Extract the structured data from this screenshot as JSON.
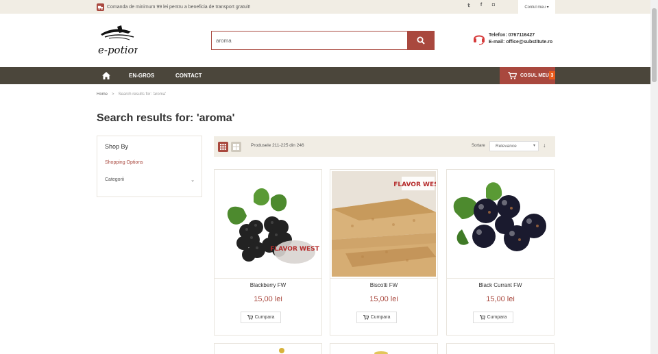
{
  "topbar": {
    "promo": "Comanda de minimum 99 lei pentru a beneficia de transport gratuit!",
    "social": [
      "twitter-icon",
      "facebook-icon",
      "instagram-icon"
    ],
    "account": "Contul meu ▾"
  },
  "header": {
    "logo_text": "e-potion",
    "search_value": "aroma",
    "phone": "Telefon: 0767116427",
    "email": "E-mail: office@substitute.ro"
  },
  "nav": {
    "items": [
      "EN-GROS",
      "CONTACT"
    ],
    "cart_label": "COSUL MEU",
    "cart_count": "3"
  },
  "breadcrumb": {
    "home": "Home",
    "sep": ">",
    "current": "Search results for: 'aroma'"
  },
  "page_title": "Search results for: 'aroma'",
  "sidebar": {
    "title": "Shop By",
    "subtitle": "Shopping Options",
    "filter": "Categorii",
    "chevron": "⌄"
  },
  "toolbar": {
    "amount": "Produsele 211-225 din 246",
    "sort_label": "Sortare",
    "sort_value": "Relevance",
    "sort_caret": "▾",
    "sort_dir": "↓"
  },
  "products": [
    {
      "name": "Blackberry FW",
      "price": "15,00 lei",
      "buy": "Cumpara",
      "badge": "FLAVOR WEST"
    },
    {
      "name": "Biscotti FW",
      "price": "15,00 lei",
      "buy": "Cumpara",
      "badge": "FLAVOR WEST"
    },
    {
      "name": "Black Currant FW",
      "price": "15,00 lei",
      "buy": "Cumpara"
    }
  ],
  "colors": {
    "accent": "#a9483e",
    "nav_bg": "#4b463b",
    "top_bg": "#f1ede4",
    "cart_badge": "#e75a1b"
  }
}
